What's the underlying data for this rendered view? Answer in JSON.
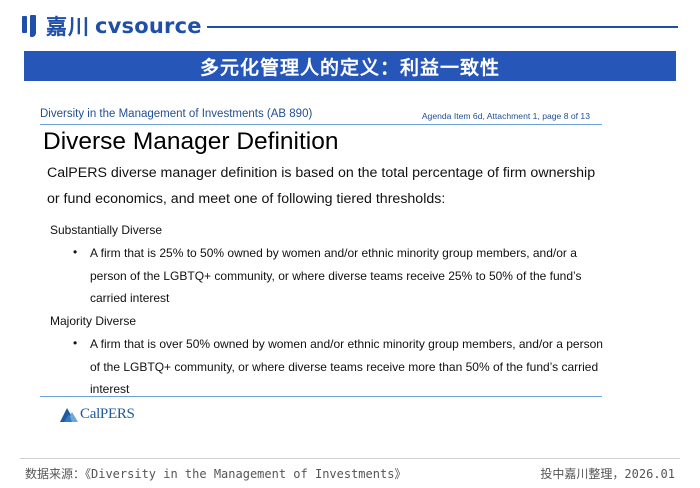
{
  "brand": {
    "logo_cn": "嘉川",
    "logo_en": "cvsource",
    "color": "#1f4fa8"
  },
  "banner": {
    "title": "多元化管理人的定义：利益一致性",
    "background": "#2556b8"
  },
  "slide": {
    "header_left": "Diversity in the Management of Investments (AB 890)",
    "header_right": "Agenda Item 6d, Attachment 1, page 8 of 13",
    "title": "Diverse Manager Definition",
    "intro": "CalPERS diverse manager definition is based on the total percentage of firm ownership or fund economics, and meet one of following tiered thresholds:",
    "tiers": [
      {
        "label": "Substantially Diverse",
        "bullet": "•",
        "text": "A firm that is 25% to 50% owned by women and/or ethnic minority group members, and/or a person of the LGBTQ+ community, or where diverse teams receive 25% to 50% of the fund’s carried interest"
      },
      {
        "label": "Majority Diverse",
        "bullet": "•",
        "text": "A firm that is over 50% owned by women and/or ethnic minority group members, and/or a person of the LGBTQ+ community, or where diverse teams receive more than 50% of the fund’s carried interest"
      }
    ],
    "footer_logo": "CalPERS",
    "footer_logo_icon": "calpers-mountain-icon"
  },
  "footer": {
    "source": "数据来源：《Diversity in the Management of Investments》",
    "credit": "投中嘉川整理，2026.01"
  }
}
